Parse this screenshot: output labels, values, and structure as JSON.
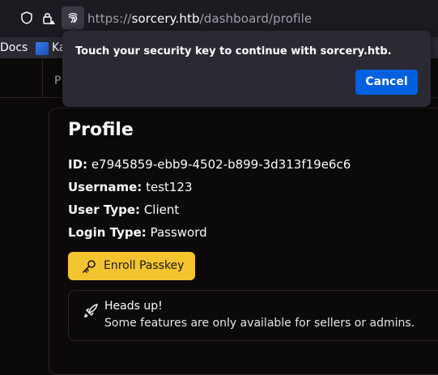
{
  "browser": {
    "url_scheme": "https://",
    "url_host": "sorcery.htb",
    "url_path": "/dashboard/profile",
    "bookmarks": [
      "Docs",
      "Ka"
    ]
  },
  "popup": {
    "message": "Touch your security key to continue with sorcery.htb.",
    "cancel_label": "Cancel"
  },
  "nav": {
    "partial_label": "P"
  },
  "profile": {
    "title": "Profile",
    "fields": [
      {
        "label": "ID:",
        "value": "e7945859-ebb9-4502-b899-3d313f19e6c6"
      },
      {
        "label": "Username:",
        "value": "test123"
      },
      {
        "label": "User Type:",
        "value": "Client"
      },
      {
        "label": "Login Type:",
        "value": "Password"
      }
    ],
    "enroll_label": "Enroll Passkey",
    "alert": {
      "title": "Heads up!",
      "description": "Some features are only available for sellers or admins."
    }
  },
  "colors": {
    "accent_button": "#f4c430",
    "popup_button": "#0060df",
    "background": "#0c0a09"
  }
}
